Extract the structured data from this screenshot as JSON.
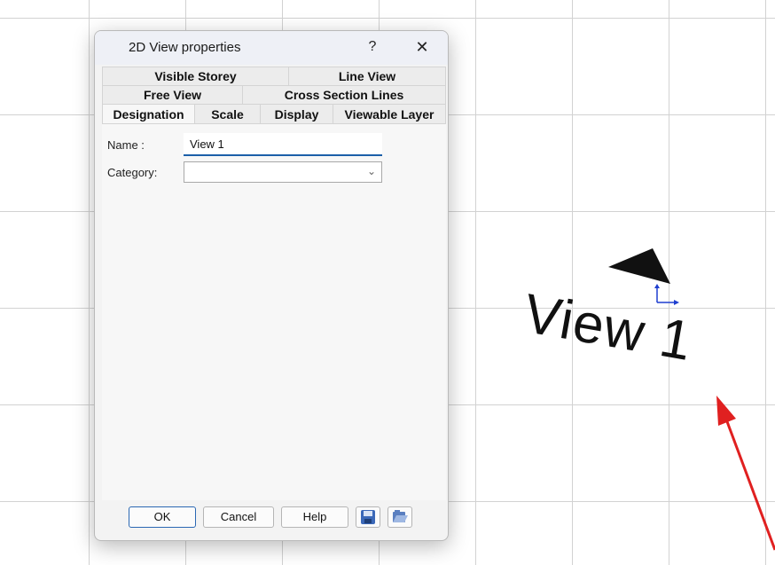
{
  "dialog": {
    "title": "2D View properties",
    "help_glyph": "?",
    "close_glyph": "✕",
    "tabs_row1": [
      "Visible Storey",
      "Line View"
    ],
    "tabs_row2": [
      "Free View",
      "Cross Section Lines"
    ],
    "tabs_row3": [
      "Designation",
      "Scale",
      "Display",
      "Viewable Layer"
    ],
    "active_tab": "Designation",
    "fields": {
      "name_label": "Name :",
      "name_value": "View 1",
      "category_label": "Category:",
      "category_value": ""
    },
    "buttons": {
      "ok": "OK",
      "cancel": "Cancel",
      "help": "Help"
    },
    "icons": [
      "save-icon",
      "open-folder-icon"
    ]
  },
  "drawing": {
    "view_label": "View 1"
  },
  "colors": {
    "accent": "#1b5fa8",
    "arrow": "#e02020",
    "marker_axis": "#1f3fd0"
  }
}
